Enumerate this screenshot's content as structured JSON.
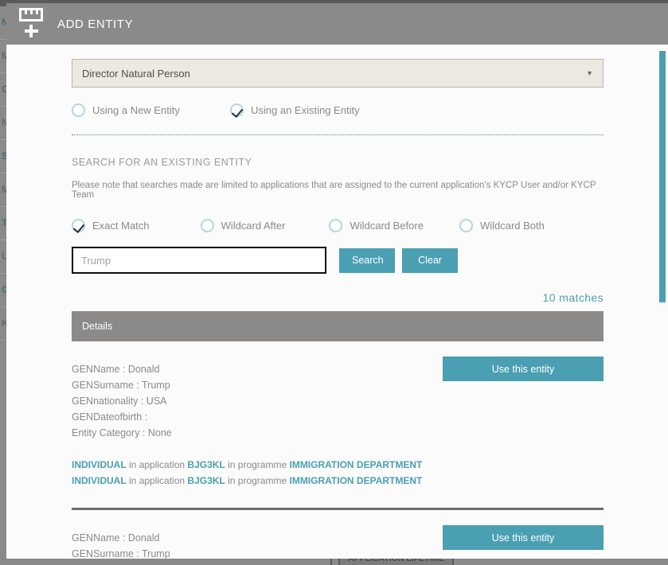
{
  "header": {
    "title": "ADD ENTITY",
    "icon": "entity-add-icon"
  },
  "form": {
    "entity_type_select": {
      "value": "Director Natural Person",
      "caret": "▼"
    },
    "entity_mode_options": [
      {
        "label": "Using a New Entity",
        "checked": false
      },
      {
        "label": "Using an Existing Entity",
        "checked": true
      }
    ]
  },
  "search_section": {
    "title": "SEARCH FOR AN EXISTING ENTITY",
    "note": "Please note that searches made are limited to applications that are assigned to the current application's KYCP User and/or KYCP Team",
    "match_options": [
      {
        "label": "Exact Match",
        "checked": true
      },
      {
        "label": "Wildcard After",
        "checked": false
      },
      {
        "label": "Wildcard Before",
        "checked": false
      },
      {
        "label": "Wildcard Both",
        "checked": false
      }
    ],
    "input": {
      "value": "Trump",
      "placeholder": "Trump"
    },
    "search_button": "Search",
    "clear_button": "Clear",
    "matches_count": "10 matches"
  },
  "results": {
    "details_header": "Details",
    "items": [
      {
        "fields": [
          "GENName : Donald",
          "GENSurname : Trump",
          "GENnationality : USA",
          "GENDateofbirth :",
          "Entity Category : None"
        ],
        "use_button": "Use this entity",
        "links": [
          {
            "type": "INDIVIDUAL",
            "mid1": "in application",
            "application": "BJG3KL",
            "mid2": "in programme",
            "programme": "IMMIGRATION DEPARTMENT"
          },
          {
            "type": "INDIVIDUAL",
            "mid1": "in application",
            "application": "BJG3KL",
            "mid2": "in programme",
            "programme": "IMMIGRATION DEPARTMENT"
          }
        ]
      },
      {
        "fields": [
          "GENName : Donald",
          "GENSurname : Trump"
        ],
        "use_button": "Use this entity",
        "links": []
      }
    ]
  },
  "background": {
    "sidebar_letters": [
      "N",
      "M",
      "C",
      "N",
      "S",
      "M",
      "T",
      "U",
      "G",
      "K"
    ],
    "bottom_label": "APPLICATION LIFETIME"
  },
  "colors": {
    "accent_teal": "#4a9fb2",
    "header_gray": "#8c8a88",
    "select_bg": "#ece9e2",
    "text_gray": "#8a8a8a"
  }
}
